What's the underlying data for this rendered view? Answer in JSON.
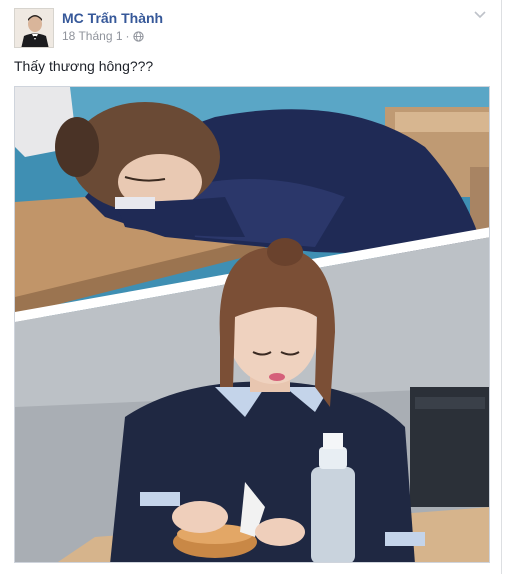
{
  "post": {
    "author": "MC Trấn Thành",
    "date": "18 Tháng 1",
    "separator": "·",
    "audience_icon": "globe-icon",
    "options_icon": "chevron-down-icon",
    "caption": "Thấy thương hông???",
    "photo": {
      "description_icon": "photo-collage"
    }
  },
  "colors": {
    "author_link": "#365899",
    "meta_text": "#90949c",
    "body_text": "#1d2129"
  }
}
